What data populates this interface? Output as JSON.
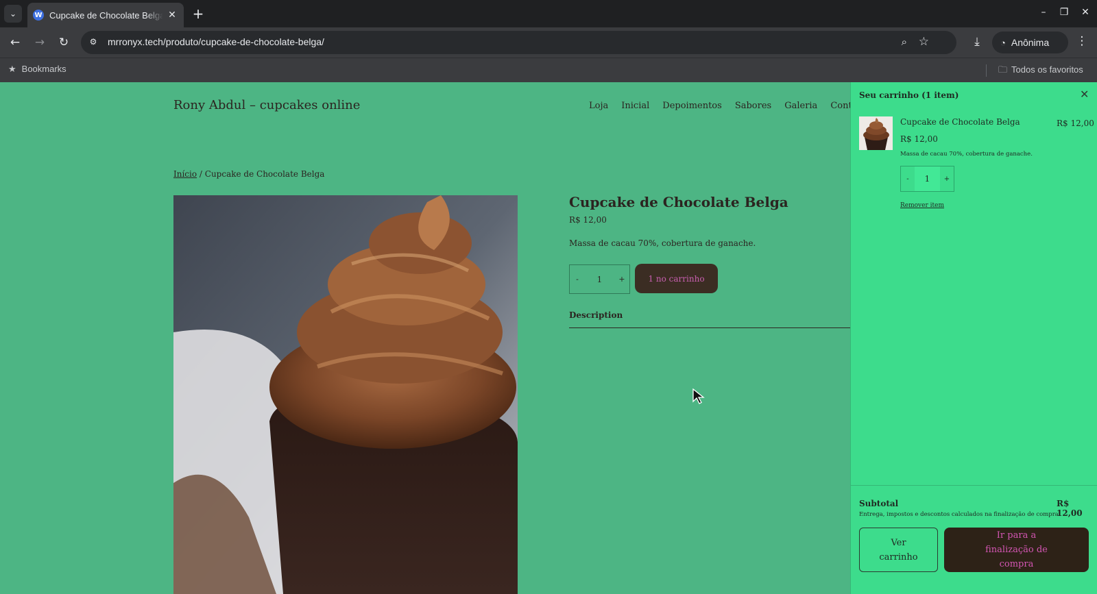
{
  "browser": {
    "tab_title": "Cupcake de Chocolate Belga",
    "url": "mrronyx.tech/produto/cupcake-de-chocolate-belga/",
    "profile_label": "Anônima",
    "bookmarks_label": "Bookmarks",
    "all_bookmarks_label": "Todos os favoritos"
  },
  "site": {
    "title": "Rony Abdul – cupcakes online",
    "nav": [
      "Loja",
      "Inicial",
      "Depoimentos",
      "Sabores",
      "Galeria",
      "Contato"
    ]
  },
  "breadcrumb": {
    "home": "Início",
    "separator": " / ",
    "current": "Cupcake de Chocolate Belga"
  },
  "product": {
    "title": "Cupcake de Chocolate Belga",
    "price": "R$ 12,00",
    "short_description": "Massa de cacau 70%, cobertura de ganache.",
    "quantity": "1",
    "qty_minus": "-",
    "qty_plus": "+",
    "add_button": "1 no carrinho",
    "tab_description": "Description"
  },
  "cart": {
    "heading": "Seu carrinho  (1 item)",
    "item": {
      "name": "Cupcake de Chocolate Belga",
      "price": "R$ 12,00",
      "line_total": "R$ 12,00",
      "meta": "Massa de cacau 70%, cobertura de ganache.",
      "quantity": "1",
      "qty_minus": "-",
      "qty_plus": "+",
      "remove": "Remover item"
    },
    "subtotal_label": "Subtotal",
    "subtotal_value": "R$ 12,00",
    "note": "Entrega, impostos e descontos calculados na finalização de compra.",
    "view_cart": "Ver carrinho",
    "checkout": "Ir para a finalização de compra"
  },
  "colors": {
    "page_bg": "#4db584",
    "drawer_bg": "#3ddc8c",
    "button_dark": "#3b2d23",
    "button_text_pink": "#c85fb0"
  }
}
